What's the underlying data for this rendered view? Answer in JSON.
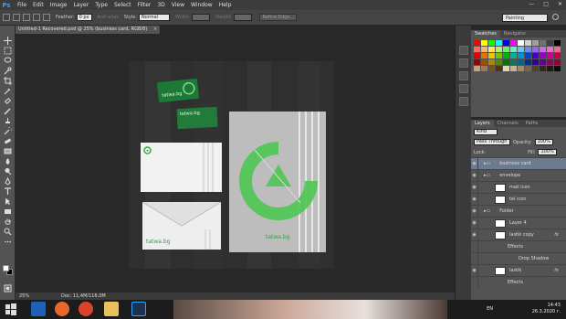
{
  "menubar": {
    "logo": "Ps",
    "items": [
      "File",
      "Edit",
      "Image",
      "Layer",
      "Type",
      "Select",
      "Filter",
      "3D",
      "View",
      "Window",
      "Help"
    ],
    "window_controls": [
      "—",
      "□",
      "✕"
    ]
  },
  "options_bar": {
    "feather_label": "Feather:",
    "feather_value": "0 px",
    "anti_alias": "Anti-alias",
    "style_label": "Style:",
    "style_value": "Normal",
    "width_label": "Width:",
    "height_label": "Height:",
    "refine_edge": "Refine Edge...",
    "workspace": "Painting"
  },
  "document_tab": {
    "title": "Untitled-1 Recovered.psd @ 25% (business card, RGB/8)",
    "close": "×"
  },
  "canvas": {
    "card_text": "tatwa.bg",
    "envelope_logo_text": "tatwa.bg",
    "folder_logo_text": "tatwa.bg"
  },
  "status_bar": {
    "zoom": "25%",
    "doc_info": "Doc: 11,4M/118,0M"
  },
  "swatches_panel": {
    "tabs": [
      "Swatches",
      "Navigator"
    ],
    "colors": [
      "#ff0000",
      "#ffff00",
      "#00ff00",
      "#00ffff",
      "#0000ff",
      "#ff00ff",
      "#ffffff",
      "#d0d0d0",
      "#a0a0a0",
      "#707070",
      "#404040",
      "#000000",
      "#ff6a6a",
      "#ffb36a",
      "#ffe66a",
      "#b8f06a",
      "#6af06a",
      "#6af0c8",
      "#6ac8f0",
      "#6a8cf0",
      "#8c6af0",
      "#c86af0",
      "#f06ac8",
      "#f06a8c",
      "#e60000",
      "#e67300",
      "#e6c800",
      "#73c800",
      "#00b400",
      "#00b496",
      "#0096c8",
      "#0046c8",
      "#4600c8",
      "#9600c8",
      "#c80096",
      "#c80046",
      "#a00000",
      "#a04b00",
      "#a08c00",
      "#4b8c00",
      "#007800",
      "#007864",
      "#006496",
      "#002d96",
      "#2d0096",
      "#640096",
      "#960064",
      "#96002d",
      "#c8a078",
      "#a07850",
      "#785028",
      "#503214",
      "#e6d2b4",
      "#c8b48c",
      "#a08c64",
      "#786446",
      "#50412d",
      "#32281a",
      "#1e1810",
      "#0f0c08"
    ]
  },
  "layers_panel": {
    "tabs": [
      "Layers",
      "Channels",
      "Paths"
    ],
    "kind": "Kind",
    "blend_mode": "Pass Through",
    "opacity_label": "Opacity:",
    "opacity_value": "100%",
    "lock_label": "Lock:",
    "fill_label": "Fill:",
    "fill_value": "100%",
    "layers": [
      {
        "name": "business card",
        "type": "group",
        "selected": true
      },
      {
        "name": "envelope",
        "type": "group"
      },
      {
        "name": "mail icon",
        "type": "layer"
      },
      {
        "name": "tel icon",
        "type": "layer"
      },
      {
        "name": "Folder",
        "type": "group"
      },
      {
        "name": "Layer 4",
        "type": "layer"
      },
      {
        "name": "lastik copy",
        "type": "layer",
        "fx": "fx"
      },
      {
        "name": "Effects",
        "type": "effect"
      },
      {
        "name": "Drop Shadow",
        "type": "effect"
      },
      {
        "name": "lastik",
        "type": "layer",
        "fx": "fx"
      },
      {
        "name": "Effects",
        "type": "effect"
      }
    ]
  },
  "taskbar": {
    "language": "EN",
    "time": "14:43",
    "date": "26.3.2020 г."
  },
  "colors": {
    "accent_green": "#2d9e3f",
    "ui_dark": "#535353",
    "selection_blue": "#6e7b8f"
  }
}
